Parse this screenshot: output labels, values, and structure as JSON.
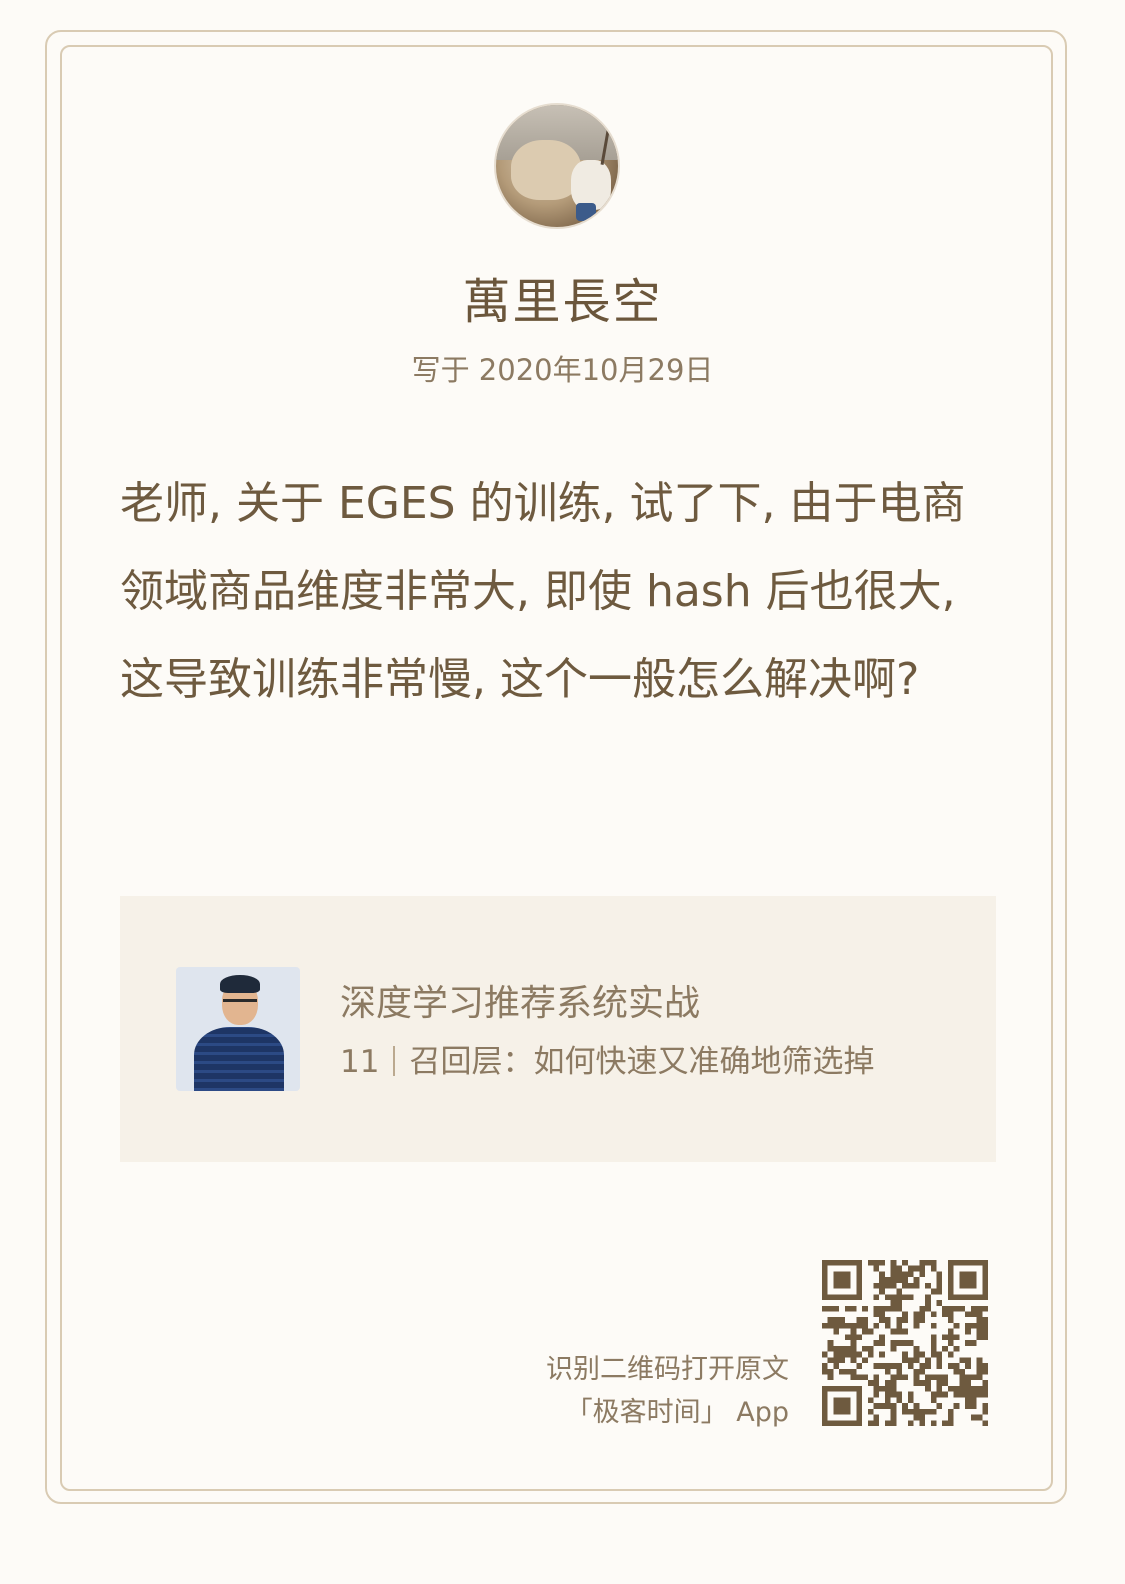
{
  "author": {
    "name": "萬里長空",
    "date": "写于 2020年10月29日"
  },
  "comment": {
    "text": "老师, 关于 EGES 的训练, 试了下, 由于电商领域商品维度非常大, 即使 hash 后也很大, 这导致训练非常慢, 这个一般怎么解决啊?"
  },
  "course": {
    "title": "深度学习推荐系统实战",
    "chapter_number": "11",
    "chapter_title": "召回层：如何快速又准确地筛选掉"
  },
  "footer": {
    "hint_line1": "识别二维码打开原文",
    "hint_line2": "「极客时间」 App"
  },
  "colors": {
    "background": "#fdfbf7",
    "text": "#6e5a3f",
    "muted": "#8c7a62",
    "card_bg": "#f6f1e8",
    "border": "#d9cbb3",
    "qr": "#6e5a3f"
  },
  "icons": [
    "author-avatar",
    "course-cover",
    "qr-code"
  ]
}
